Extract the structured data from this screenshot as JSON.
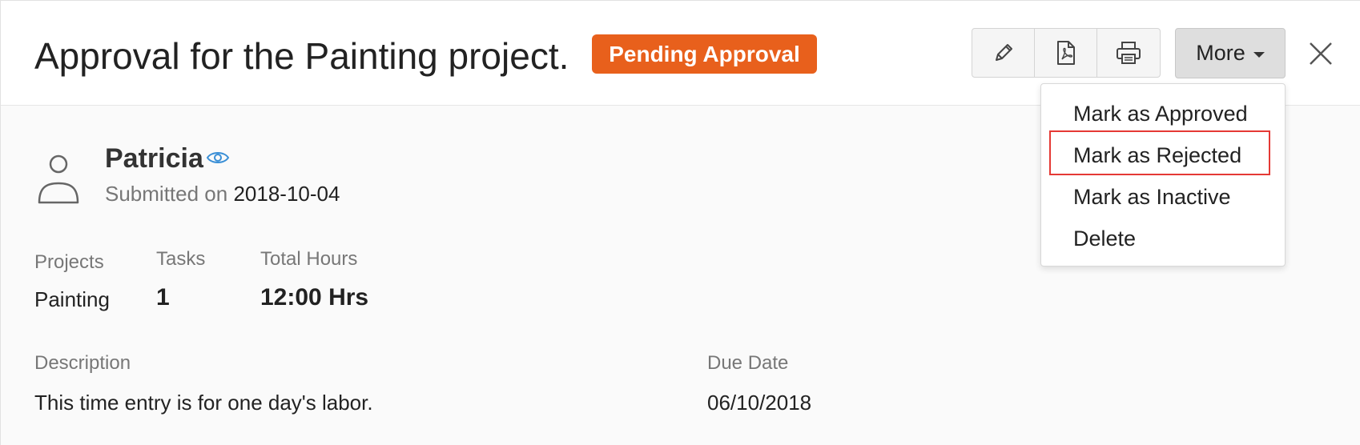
{
  "header": {
    "title": "Approval for the Painting project.",
    "status_badge": "Pending Approval",
    "more_label": "More"
  },
  "dropdown": {
    "items": [
      {
        "label": "Mark as Approved"
      },
      {
        "label": "Mark as Rejected",
        "highlighted": true
      },
      {
        "label": "Mark as Inactive"
      },
      {
        "label": "Delete"
      }
    ]
  },
  "submitter": {
    "name": "Patricia",
    "submitted_prefix": "Submitted on",
    "submitted_date": "2018-10-04"
  },
  "stats": {
    "projects_label": "Projects",
    "projects_value": "Painting",
    "tasks_label": "Tasks",
    "tasks_value": "1",
    "hours_label": "Total Hours",
    "hours_value": "12:00 Hrs"
  },
  "details": {
    "description_label": "Description",
    "description_value": "This time entry is for one day's labor.",
    "due_label": "Due Date",
    "due_value": "06/10/2018"
  },
  "colors": {
    "badge": "#e8601c",
    "highlight_border": "#e53935",
    "eye_icon": "#3a8fd6"
  },
  "icons": [
    "pencil-icon",
    "pdf-icon",
    "printer-icon",
    "caret-down-icon",
    "close-icon",
    "user-avatar-icon",
    "eye-icon"
  ]
}
